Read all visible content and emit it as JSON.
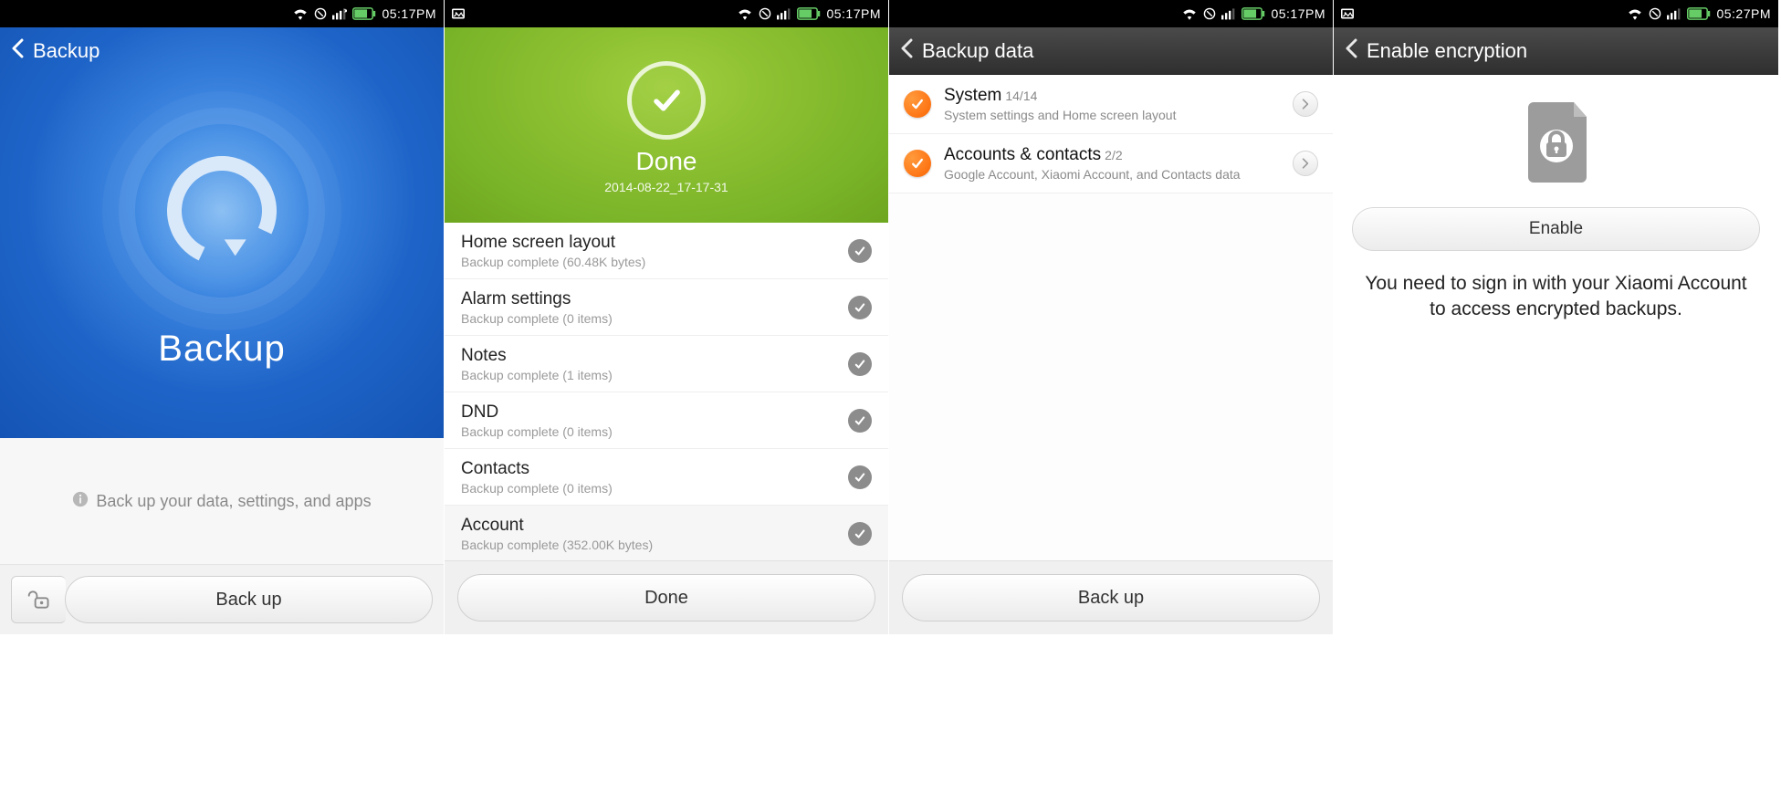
{
  "status_bar": {
    "time_a": "05:17PM",
    "time_b": "05:27PM"
  },
  "screen1": {
    "header_title": "Backup",
    "hero_label": "Backup",
    "hint_text": "Back up your data, settings, and apps",
    "button_label": "Back up"
  },
  "screen2": {
    "done_label": "Done",
    "done_timestamp": "2014-08-22_17-17-31",
    "items": [
      {
        "title": "Home screen layout",
        "subtitle": "Backup complete (60.48K  bytes)"
      },
      {
        "title": "Alarm settings",
        "subtitle": "Backup complete (0  items)"
      },
      {
        "title": "Notes",
        "subtitle": "Backup complete (1  items)"
      },
      {
        "title": "DND",
        "subtitle": "Backup complete (0  items)"
      },
      {
        "title": "Contacts",
        "subtitle": "Backup complete (0  items)"
      },
      {
        "title": "Account",
        "subtitle": "Backup complete (352.00K  bytes)"
      }
    ],
    "button_label": "Done"
  },
  "screen3": {
    "header_title": "Backup data",
    "items": [
      {
        "title": "System",
        "count": "14/14",
        "subtitle": "System settings and Home screen layout"
      },
      {
        "title": "Accounts & contacts",
        "count": "2/2",
        "subtitle": "Google Account, Xiaomi Account, and Contacts data"
      }
    ],
    "button_label": "Back up"
  },
  "screen4": {
    "header_title": "Enable encryption",
    "enable_label": "Enable",
    "message": "You need to sign in with your Xiaomi Account to access encrypted backups."
  }
}
